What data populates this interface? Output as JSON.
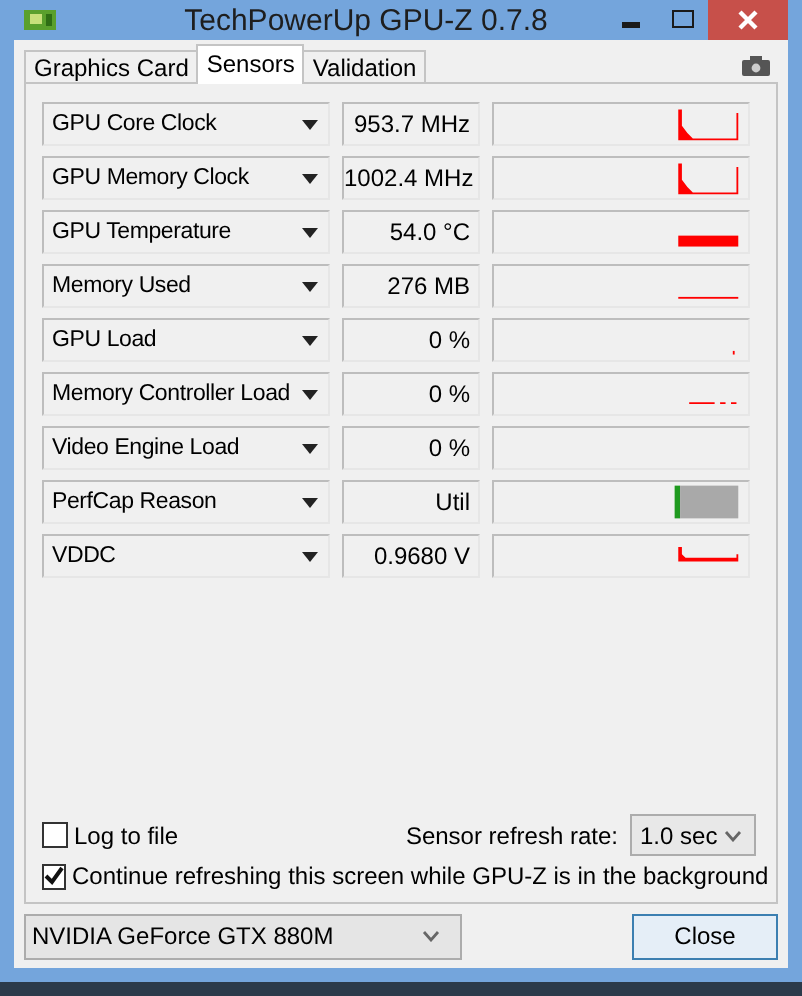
{
  "window": {
    "title": "TechPowerUp GPU-Z 0.7.8"
  },
  "tabs": [
    {
      "label": "Graphics Card",
      "selected": false
    },
    {
      "label": "Sensors",
      "selected": true
    },
    {
      "label": "Validation",
      "selected": false
    }
  ],
  "sensors": [
    {
      "name": "GPU Core Clock",
      "value": "953.7 MHz",
      "kind": "spike"
    },
    {
      "name": "GPU Memory Clock",
      "value": "1002.4 MHz",
      "kind": "spike"
    },
    {
      "name": "GPU Temperature",
      "value": "54.0 °C",
      "kind": "band"
    },
    {
      "name": "Memory Used",
      "value": "276 MB",
      "kind": "line"
    },
    {
      "name": "GPU Load",
      "value": "0 %",
      "kind": "dot"
    },
    {
      "name": "Memory Controller Load",
      "value": "0 %",
      "kind": "dashes"
    },
    {
      "name": "Video Engine Load",
      "value": "0 %",
      "kind": "empty"
    },
    {
      "name": "PerfCap Reason",
      "value": "Util",
      "kind": "perfcap"
    },
    {
      "name": "VDDC",
      "value": "0.9680 V",
      "kind": "step"
    }
  ],
  "log_to_file": {
    "label": "Log to file",
    "checked": false
  },
  "refresh_rate": {
    "label": "Sensor refresh rate:",
    "value": "1.0 sec"
  },
  "background_refresh": {
    "label": "Continue refreshing this screen while GPU-Z is in the background",
    "checked": true
  },
  "card_select": {
    "value": "NVIDIA GeForce GTX 880M"
  },
  "close_button": {
    "label": "Close"
  }
}
